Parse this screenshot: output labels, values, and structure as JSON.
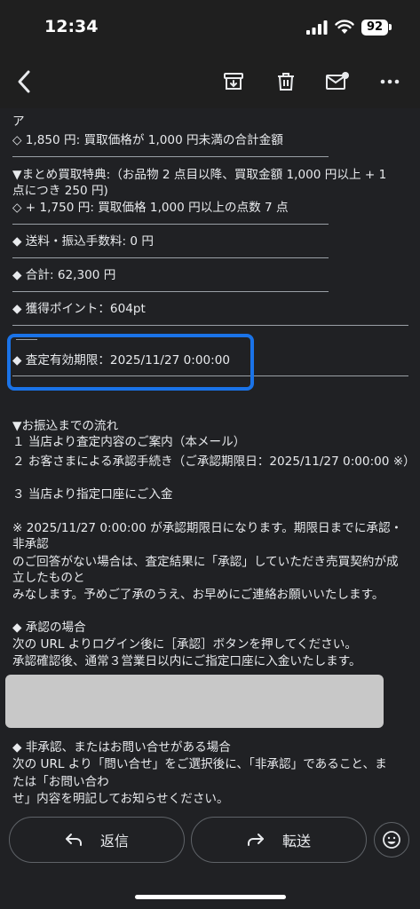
{
  "status": {
    "time": "12:34",
    "battery": "92"
  },
  "toolbar": {
    "back_icon": "chevron-left-icon",
    "archive_icon": "archive-icon",
    "delete_icon": "trash-icon",
    "mark_unread_icon": "mail-unread-icon",
    "more_icon": "more-horizontal-icon"
  },
  "email": {
    "lines": [
      "ア",
      "◇ 1,850 円: 買取価格が 1,000 円未満の合計金額",
      "▼まとめ買取特典:（お品物 2 点目以降、買取金額 1,000 円以上 + 1",
      "点につき 250 円)",
      "◇ + 1,750 円: 買取価格 1,000 円以上の点数 7 点",
      "◆ 送料・振込手数料: 0 円",
      "◆ 合計: 62,300 円",
      "◆ 獲得ポイント：604pt",
      "◆ 査定有効期限：2025/11/27 0:00:00",
      "▼お振込までの流れ",
      "１ 当店より査定内容のご案内（本メール）",
      "２ お客さまによる承認手続き（ご承認期限日：2025/11/27 0:00:00 ※）",
      "３ 当店より指定口座にご入金",
      "※ 2025/11/27 0:00:00 が承認期限日になります。期限日までに承認・",
      "非承認",
      "のご回答がない場合は、査定結果に「承認」していただき売買契約が成",
      "立したものと",
      "みなします。予めご了承のうえ、お早めにご連絡お願いいたします。",
      "◆ 承認の場合",
      "次の URL よりログイン後に［承認］ボタンを押してください。",
      "承認確認後、通常３営業日以内にご指定口座に入金いたします。",
      "◆ 非承認、またはお問い合せがある場合",
      "次の URL より「問い合せ」をご選択後に、「非承認」であること、ま",
      "たは「お問い合わ",
      "せ」内容を明記してお知らせください。"
    ]
  },
  "actions": {
    "reply_label": "返信",
    "forward_label": "転送"
  },
  "colors": {
    "highlight": "#1a73e8",
    "background": "#202124"
  }
}
